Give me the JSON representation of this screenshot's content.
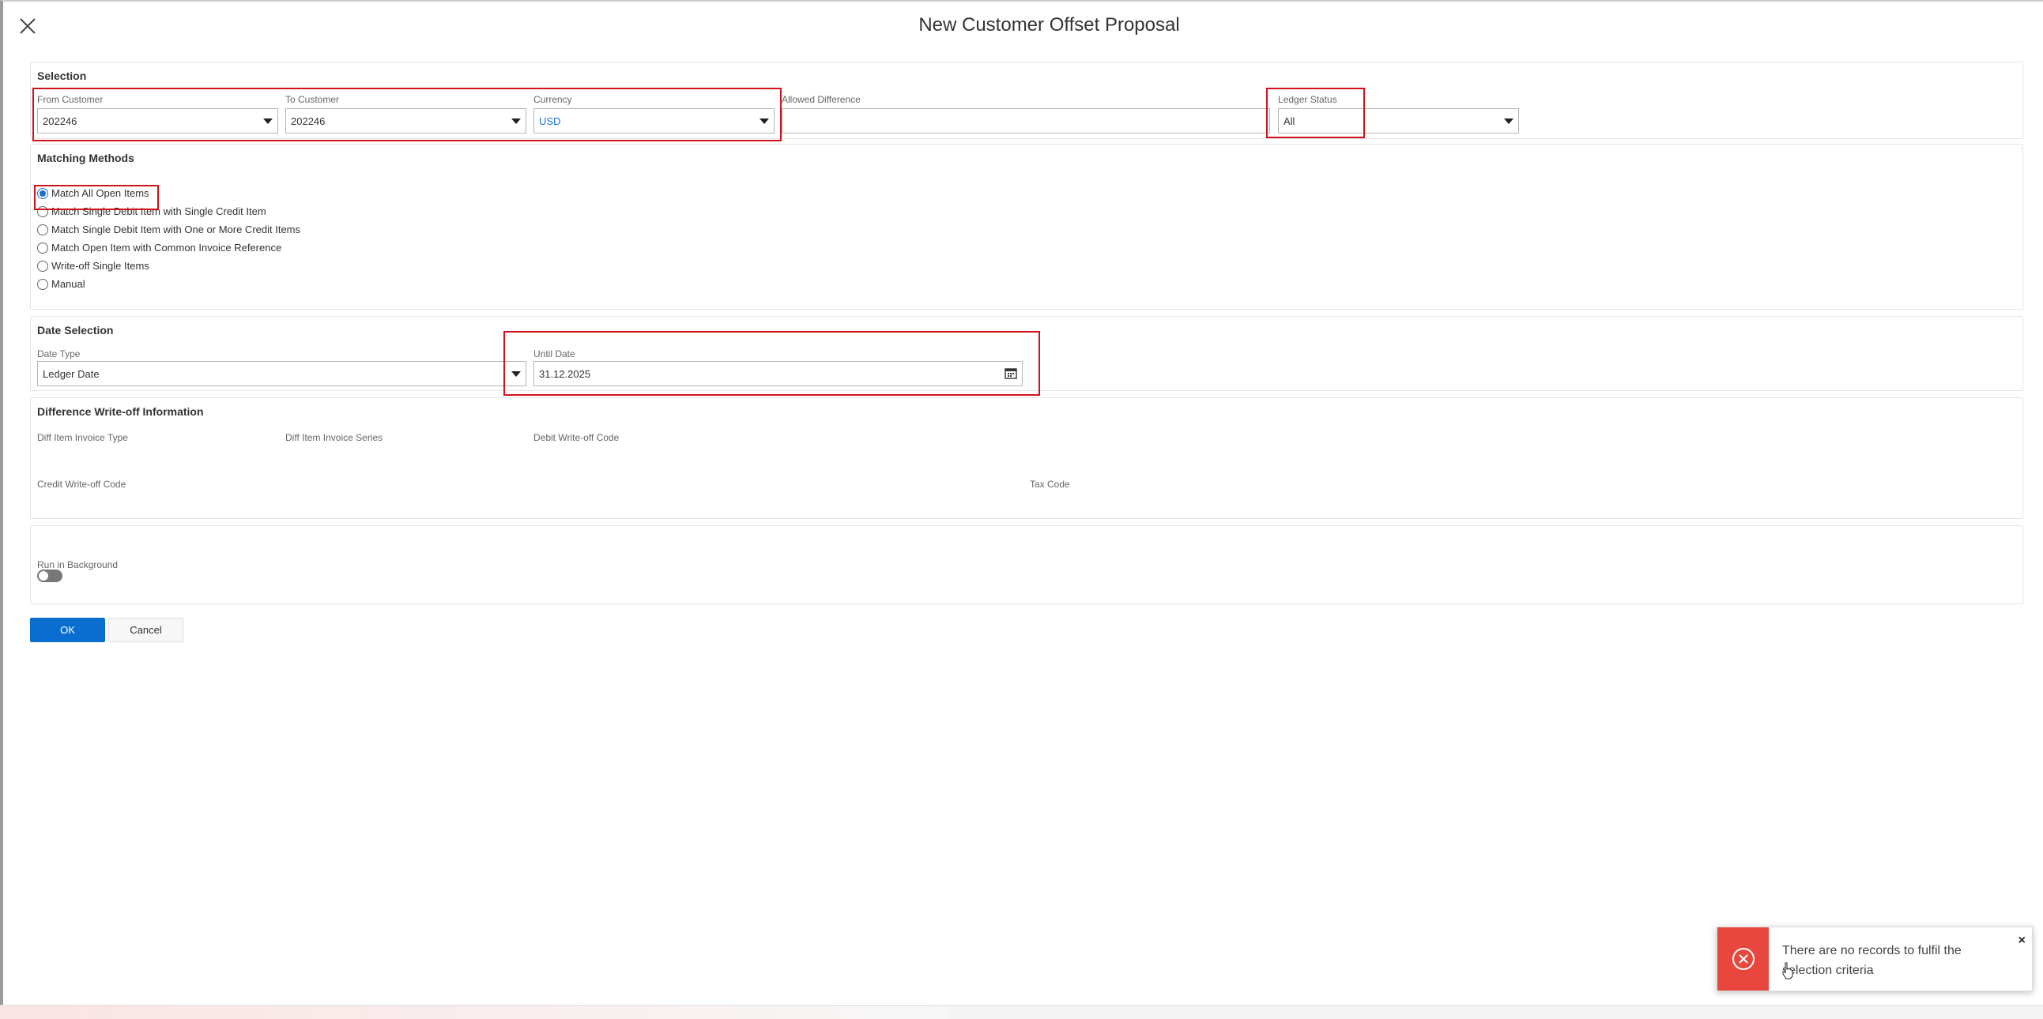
{
  "dialog": {
    "title": "New Customer Offset Proposal"
  },
  "selection": {
    "title": "Selection",
    "from_customer": {
      "label": "From Customer",
      "value": "202246"
    },
    "to_customer": {
      "label": "To Customer",
      "value": "202246"
    },
    "currency": {
      "label": "Currency",
      "value": "USD"
    },
    "allowed_difference": {
      "label": "Allowed Difference",
      "value": ""
    },
    "ledger_status": {
      "label": "Ledger Status",
      "value": "All"
    }
  },
  "matching_methods": {
    "title": "Matching Methods",
    "options": [
      {
        "label": "Match All Open Items",
        "checked": true
      },
      {
        "label": "Match Single Debit Item with Single Credit Item",
        "checked": false
      },
      {
        "label": "Match Single Debit Item with One or More Credit Items",
        "checked": false
      },
      {
        "label": "Match Open Item with Common Invoice Reference",
        "checked": false
      },
      {
        "label": "Write-off Single Items",
        "checked": false
      },
      {
        "label": "Manual",
        "checked": false
      }
    ]
  },
  "date_selection": {
    "title": "Date Selection",
    "date_type": {
      "label": "Date Type",
      "value": "Ledger Date"
    },
    "until_date": {
      "label": "Until Date",
      "value": "31.12.2025"
    }
  },
  "writeoff": {
    "title": "Difference Write-off Information",
    "diff_item_invoice_type": "Diff Item Invoice Type",
    "diff_item_invoice_series": "Diff Item Invoice Series",
    "debit_writeoff_code": "Debit Write-off Code",
    "credit_writeoff_code": "Credit Write-off Code",
    "tax_code": "Tax Code"
  },
  "background": {
    "label": "Run in Background",
    "enabled": false
  },
  "actions": {
    "ok": "OK",
    "cancel": "Cancel"
  },
  "toast": {
    "message": "There are no records to fulfil the selection criteria",
    "close": "×"
  },
  "colors": {
    "primary": "#0a6ed1",
    "highlight": "#d0121b",
    "error": "#e8473e",
    "link": "#1a6fd1"
  },
  "icons": {
    "close": "close-icon",
    "calendar": "calendar-icon",
    "error": "error-circle-icon"
  }
}
